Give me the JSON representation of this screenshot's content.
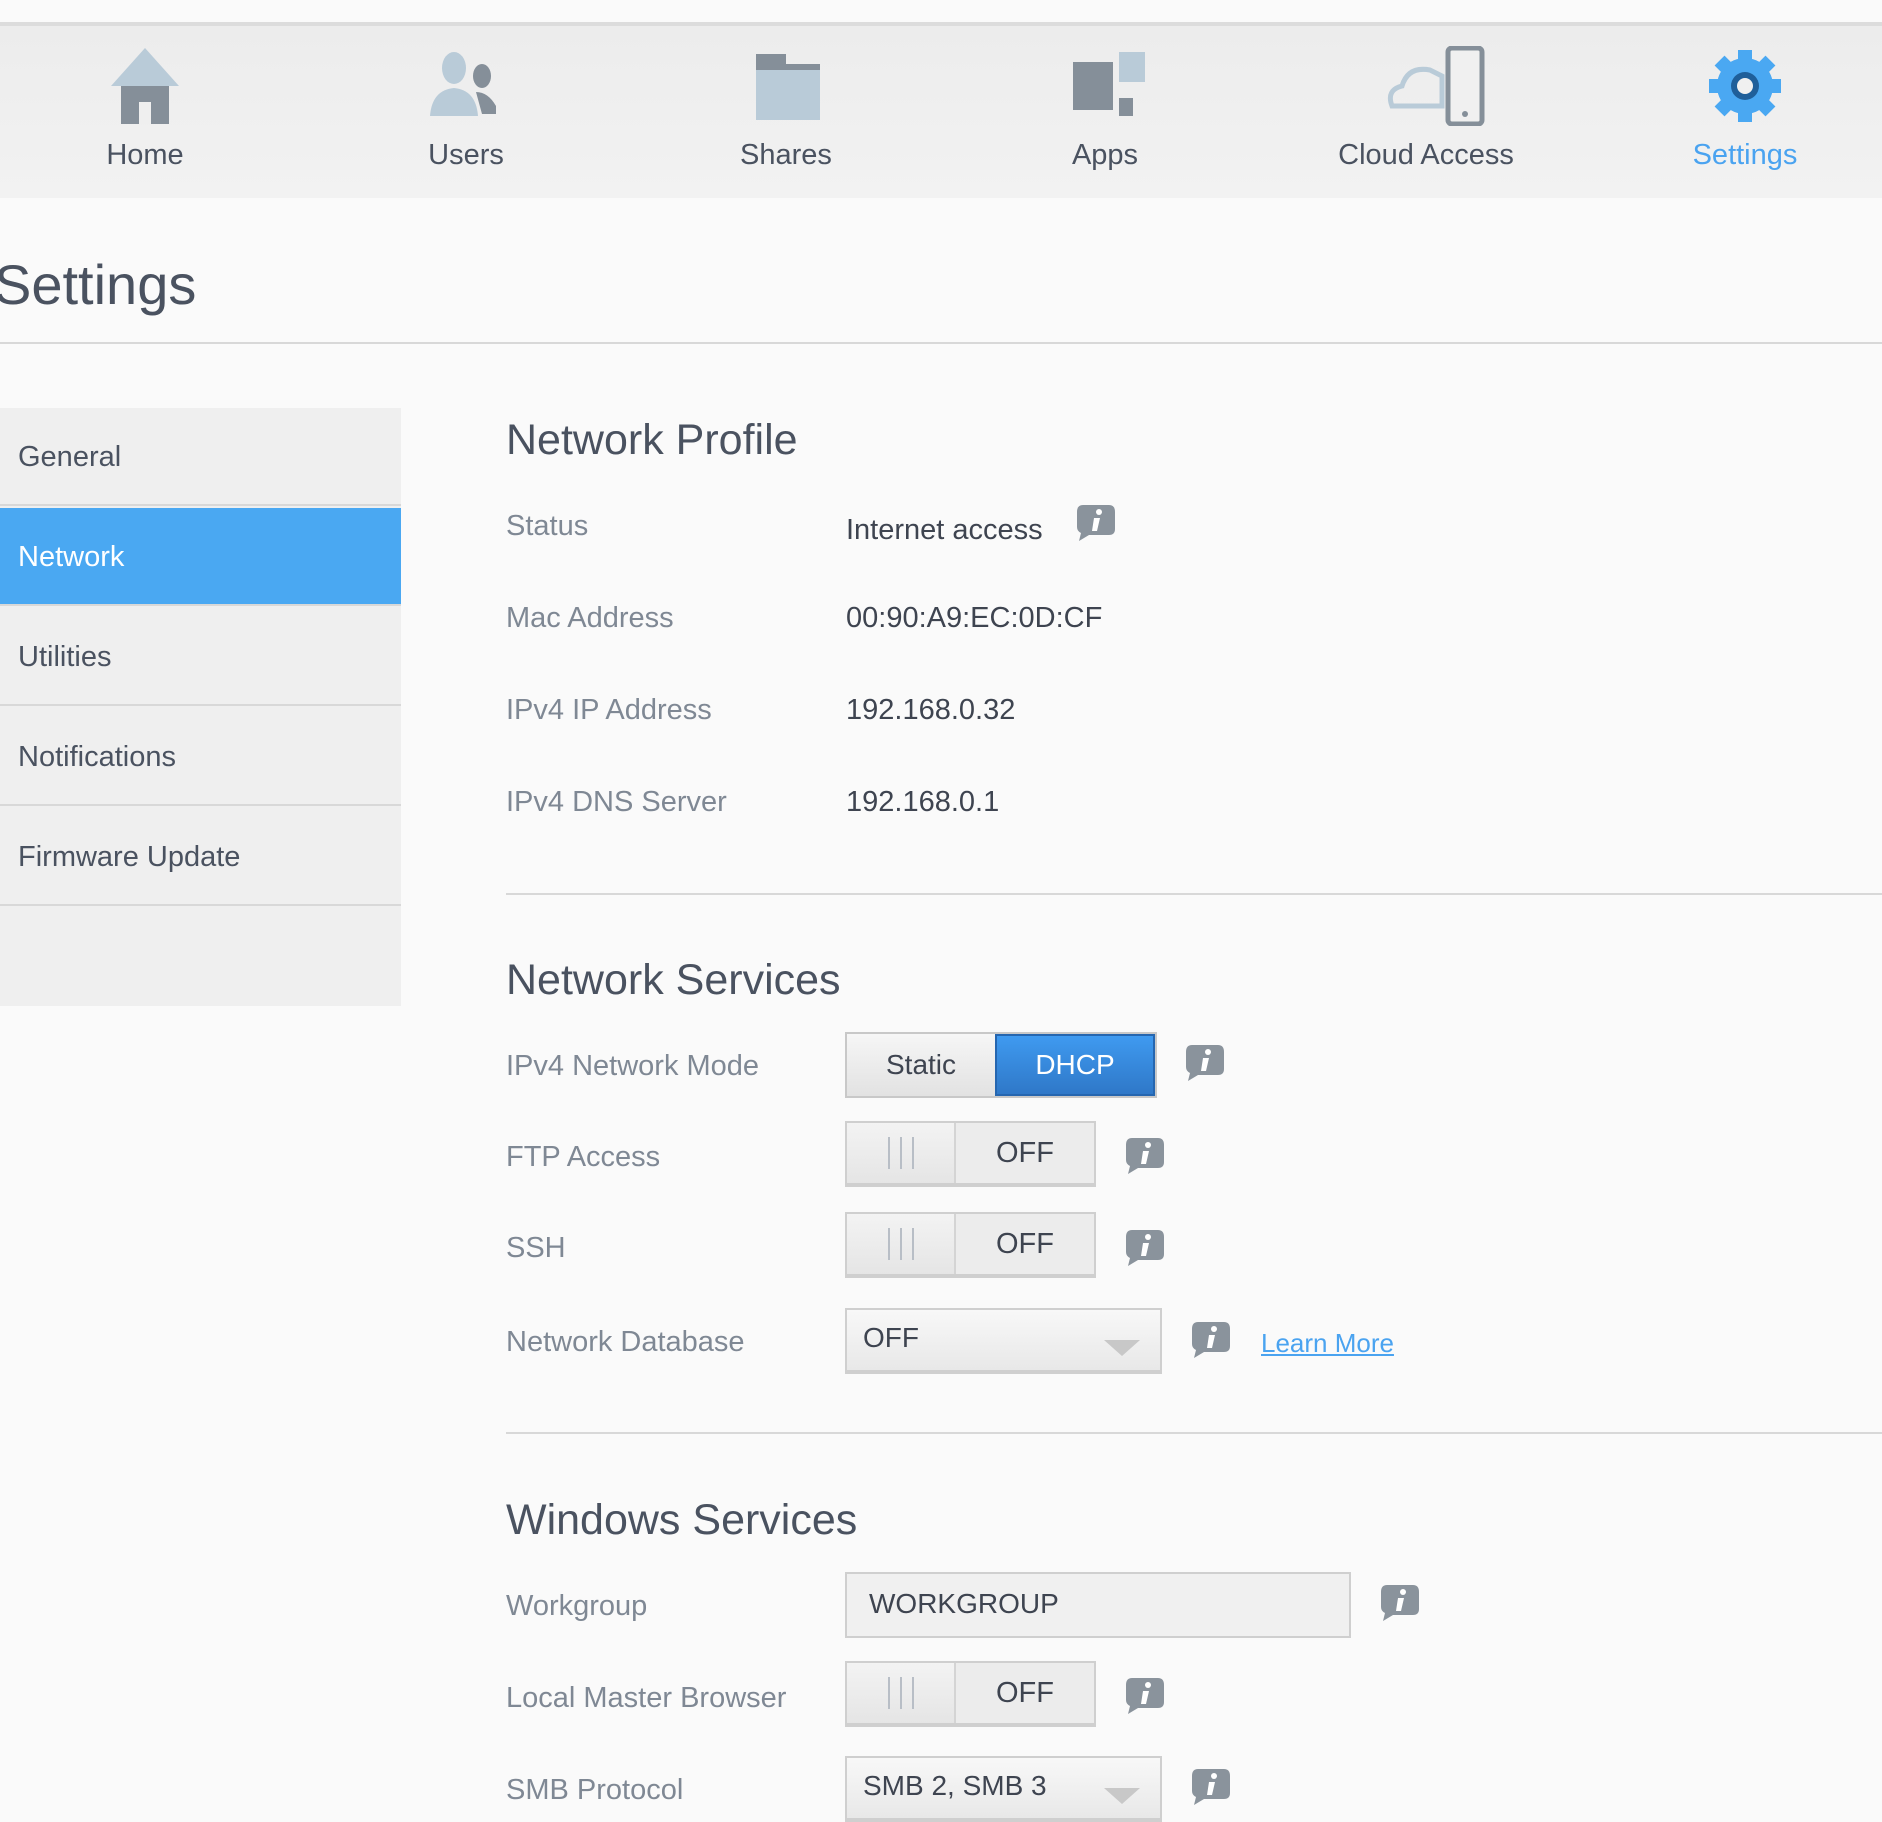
{
  "nav": [
    {
      "label": "Home",
      "icon": "home-icon"
    },
    {
      "label": "Users",
      "icon": "users-icon"
    },
    {
      "label": "Shares",
      "icon": "shares-folder-icon"
    },
    {
      "label": "Apps",
      "icon": "apps-icon"
    },
    {
      "label": "Cloud Access",
      "icon": "cloud-access-icon"
    },
    {
      "label": "Settings",
      "icon": "gear-icon",
      "active": true
    }
  ],
  "page_title": "Settings",
  "sidebar": {
    "items": [
      {
        "label": "General"
      },
      {
        "label": "Network",
        "active": true
      },
      {
        "label": "Utilities"
      },
      {
        "label": "Notifications"
      },
      {
        "label": "Firmware Update"
      }
    ]
  },
  "network_profile": {
    "title": "Network Profile",
    "rows": [
      {
        "label": "Status",
        "value": "Internet access"
      },
      {
        "label": "Mac Address",
        "value": "00:90:A9:EC:0D:CF"
      },
      {
        "label": "IPv4 IP Address",
        "value": "192.168.0.32"
      },
      {
        "label": "IPv4 DNS Server",
        "value": "192.168.0.1"
      }
    ]
  },
  "network_services": {
    "title": "Network Services",
    "mode": {
      "label": "IPv4 Network Mode",
      "options": [
        "Static",
        "DHCP"
      ],
      "selected": "DHCP"
    },
    "ftp": {
      "label": "FTP Access",
      "state": "OFF"
    },
    "ssh": {
      "label": "SSH",
      "state": "OFF"
    },
    "netdb": {
      "label": "Network Database",
      "value": "OFF",
      "learn_more": "Learn More"
    }
  },
  "windows_services": {
    "title": "Windows Services",
    "workgroup": {
      "label": "Workgroup",
      "value": "WORKGROUP"
    },
    "lmb": {
      "label": "Local Master Browser",
      "state": "OFF"
    },
    "smb": {
      "label": "SMB Protocol",
      "value": "SMB 2, SMB 3"
    }
  },
  "colors": {
    "accent": "#4aa8f2",
    "dhcp": "#2f7fd0"
  }
}
